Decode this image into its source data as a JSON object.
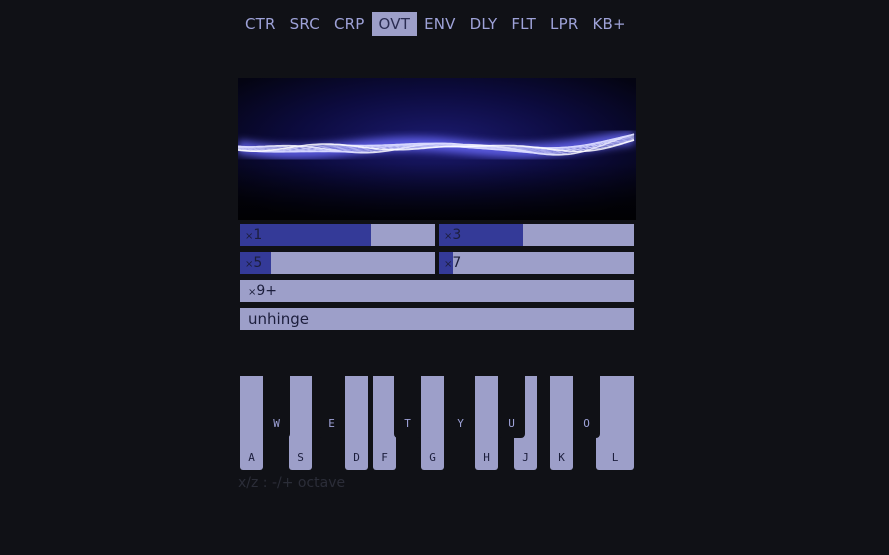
{
  "tabs": [
    {
      "label": "CTR",
      "active": false
    },
    {
      "label": "SRC",
      "active": false
    },
    {
      "label": "CRP",
      "active": false
    },
    {
      "label": "OVT",
      "active": true
    },
    {
      "label": "ENV",
      "active": false
    },
    {
      "label": "DLY",
      "active": false
    },
    {
      "label": "FLT",
      "active": false
    },
    {
      "label": "LPR",
      "active": false
    },
    {
      "label": "KB+",
      "active": false
    }
  ],
  "sliders": {
    "x1": {
      "prefix": "×",
      "label": "1",
      "value": 0.67
    },
    "x3": {
      "prefix": "×",
      "label": "3",
      "value": 0.43
    },
    "x5": {
      "prefix": "×",
      "label": "5",
      "value": 0.16
    },
    "x7": {
      "prefix": "×",
      "label": "7",
      "value": 0.07
    },
    "x9": {
      "prefix": "×",
      "label": "9+"
    }
  },
  "mode": {
    "label": "unhinge"
  },
  "keyboard": {
    "white_keys": [
      "A",
      "S",
      "D",
      "F",
      "G",
      "H",
      "J",
      "K",
      "L"
    ],
    "black_keys": [
      "W",
      "E",
      "T",
      "Y",
      "U",
      "O"
    ]
  },
  "hint": "x/z : -/+ octave",
  "colors": {
    "background": "#101116",
    "panel": "#9d9fc9",
    "fill": "#343a98",
    "wave": "#6a6cff"
  }
}
